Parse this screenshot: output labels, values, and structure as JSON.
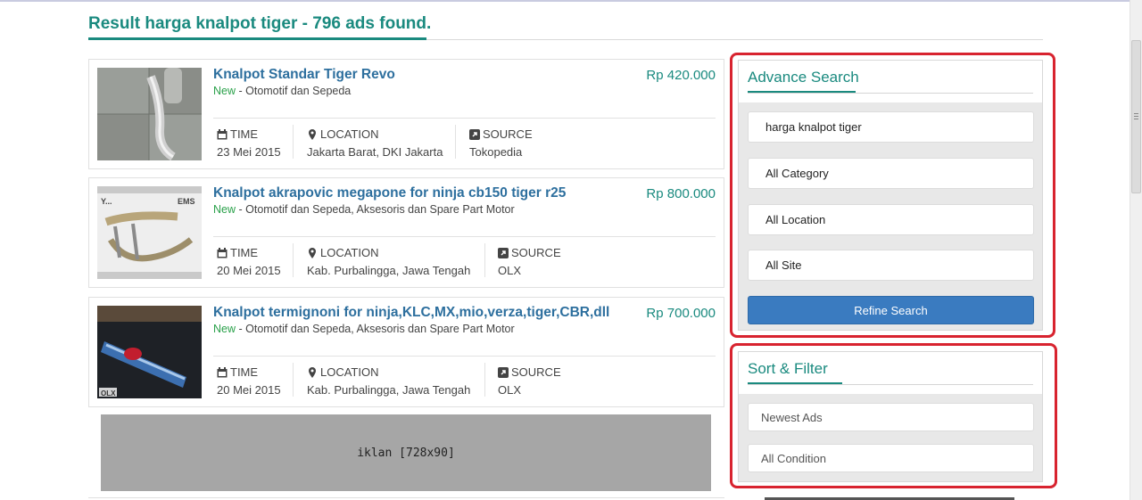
{
  "header": {
    "title": "Result harga knalpot tiger - 796 ads found."
  },
  "listings": [
    {
      "title": "Knalpot Standar Tiger Revo",
      "price": "Rp 420.000",
      "condition": "New",
      "categories": " - Otomotif dan Sepeda",
      "time_label": "TIME",
      "time": "23 Mei 2015",
      "location_label": "LOCATION",
      "location": "Jakarta Barat, DKI Jakarta",
      "source_label": "SOURCE",
      "source": "Tokopedia"
    },
    {
      "title": "Knalpot akrapovic megapone for ninja cb150 tiger r25",
      "price": "Rp 800.000",
      "condition": "New",
      "categories": " - Otomotif dan Sepeda, Aksesoris dan Spare Part Motor",
      "time_label": "TIME",
      "time": "20 Mei 2015",
      "location_label": "LOCATION",
      "location": "Kab. Purbalingga, Jawa Tengah",
      "source_label": "SOURCE",
      "source": "OLX"
    },
    {
      "title": "Knalpot termignoni for ninja,KLC,MX,mio,verza,tiger,CBR,dll",
      "price": "Rp 700.000",
      "condition": "New",
      "categories": " - Otomotif dan Sepeda, Aksesoris dan Spare Part Motor",
      "time_label": "TIME",
      "time": "20 Mei 2015",
      "location_label": "LOCATION",
      "location": "Kab. Purbalingga, Jawa Tengah",
      "source_label": "SOURCE",
      "source": "OLX"
    }
  ],
  "ad_banner": {
    "label": "iklan [728x90]"
  },
  "advance_search": {
    "title": "Advance Search",
    "keyword": "harga knalpot tiger",
    "category": "All Category",
    "location": "All Location",
    "site": "All Site",
    "button": "Refine Search"
  },
  "sort_filter": {
    "title": "Sort & Filter",
    "sort": "Newest Ads",
    "condition": "All Condition"
  },
  "icons": {
    "time": "calendar-icon",
    "location": "map-marker-icon",
    "source": "external-link-icon"
  },
  "colors": {
    "accent": "#1a8a7f",
    "link": "#2d6f9e",
    "new_badge": "#2aa14a",
    "button": "#3a7bc0",
    "highlight": "#d8232f"
  }
}
